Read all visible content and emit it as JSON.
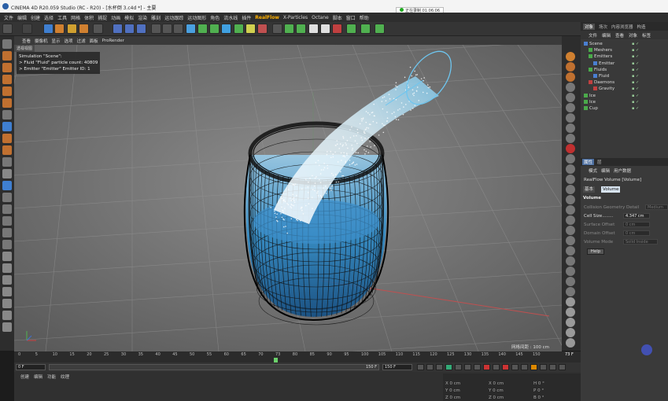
{
  "titlebar": {
    "title": "CINEMA 4D R20.059 Studio (RC - R20) - [水杯倒 3.c4d *] - 主要"
  },
  "recording": {
    "label": "正在录制 01:06:06"
  },
  "menu": {
    "items": [
      "文件",
      "编辑",
      "创建",
      "选择",
      "工具",
      "网格",
      "体积",
      "捕捉",
      "动画",
      "模拟",
      "渲染",
      "雕刻",
      "运动跟踪",
      "运动图形",
      "角色",
      "流水线",
      "插件",
      "RealFlow",
      "X-Particles",
      "Octane",
      "脚本",
      "窗口",
      "帮助"
    ]
  },
  "viewport_menu": {
    "items": [
      "查看",
      "摄像机",
      "显示",
      "选项",
      "过滤",
      "面板",
      "ProRender"
    ]
  },
  "viewport": {
    "tab": "透视视图",
    "hud": [
      "Simulation \"Scene\":",
      "> Fluid \"Fluid\" particle count: 40809",
      "> Emitter \"Emitter\" Emitter ID: 1"
    ],
    "grid_label": "网格间距 : 100 cm"
  },
  "timeline": {
    "ticks": [
      "0",
      "5",
      "10",
      "15",
      "20",
      "25",
      "30",
      "35",
      "40",
      "45",
      "50",
      "55",
      "60",
      "65",
      "70",
      "73",
      "80",
      "85",
      "90",
      "95",
      "100",
      "105",
      "110",
      "115",
      "120",
      "125",
      "130",
      "135",
      "140",
      "145",
      "150"
    ],
    "current_frame": "73 F"
  },
  "transport": {
    "start": "0 F",
    "end_a": "150 F",
    "end_b": "150 F"
  },
  "bottom_tabs": [
    "创建",
    "编辑",
    "功能",
    "纹理"
  ],
  "coords": {
    "x": "X  0 cm",
    "y": "Y  0 cm",
    "z": "Z  0 cm",
    "x2": "X  0 cm",
    "y2": "Y  0 cm",
    "z2": "Z  0 cm",
    "h": "H  0 °",
    "p": "P  0 °",
    "b": "B  0 °"
  },
  "right_tabs": [
    "对象",
    "场次",
    "内容浏览器",
    "构造"
  ],
  "object_menu": [
    "文件",
    "编辑",
    "查看",
    "对象",
    "标签"
  ],
  "objects": [
    {
      "label": "Scene",
      "indent": 0,
      "icon_color": "#4a7fd1"
    },
    {
      "label": "Meshers",
      "indent": 1,
      "icon_color": "#4aaa4a"
    },
    {
      "label": "Emitters",
      "indent": 1,
      "icon_color": "#4aaa4a"
    },
    {
      "label": "Emitter",
      "indent": 2,
      "icon_color": "#4a7fd1"
    },
    {
      "label": "Fluids",
      "indent": 1,
      "icon_color": "#4aaa4a"
    },
    {
      "label": "Fluid",
      "indent": 2,
      "icon_color": "#4a7fd1"
    },
    {
      "label": "Daemons",
      "indent": 1,
      "icon_color": "#c04040"
    },
    {
      "label": "Gravity",
      "indent": 2,
      "icon_color": "#c04040"
    },
    {
      "label": "Ice",
      "indent": 0,
      "icon_color": "#4aaa4a"
    },
    {
      "label": "Ice",
      "indent": 0,
      "icon_color": "#4aaa4a"
    },
    {
      "label": "Cup",
      "indent": 0,
      "icon_color": "#4aaa4a"
    }
  ],
  "attr_tabs": [
    "属性",
    "层"
  ],
  "attr_menu": [
    "模式",
    "编辑",
    "用户数据"
  ],
  "attr": {
    "object_name": "RealFlow Volume [Volume]",
    "sub_tabs": [
      "基本",
      "Volume"
    ],
    "section": "Volume",
    "rows": [
      {
        "label": "Collision Geometry Detail",
        "value": "Medium"
      },
      {
        "label": "Cell Size........",
        "value": "4.347 cm"
      },
      {
        "label": "Surface Offset",
        "value": "0 cm"
      },
      {
        "label": "Domain Offset",
        "value": "0 cm"
      },
      {
        "label": "Volume Mode",
        "value": "Solid Inside"
      }
    ],
    "help": "Help"
  },
  "colors": {
    "accent": "#4d6fa0",
    "realflow": "#ffb000",
    "particles": "#1e78c0",
    "ok": "#4caf50"
  }
}
